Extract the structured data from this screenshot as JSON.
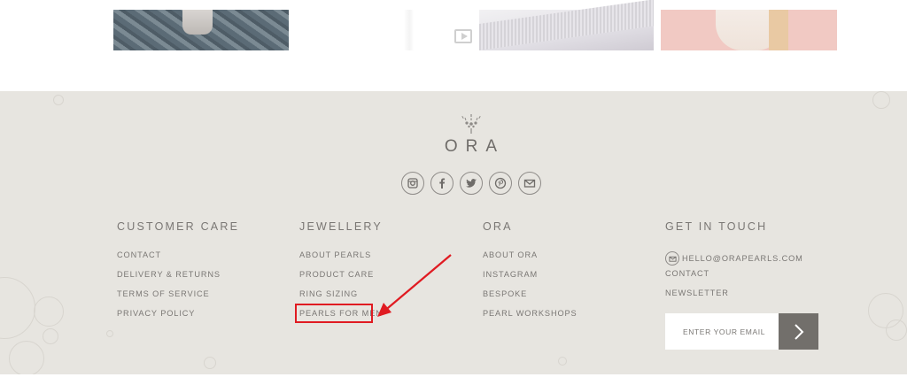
{
  "brand": {
    "name": "ORA",
    "text_color": "#6f6c69"
  },
  "colors": {
    "footer_bg": "#e7e5e0",
    "link_text": "#7a7774",
    "highlight": "#e01b22",
    "submit_bg": "#726f6b"
  },
  "thumbnails": [
    {
      "name": "photo-cobblestone"
    },
    {
      "name": "video-thumbnail",
      "icon": "play-icon"
    },
    {
      "name": "photo-white-wall"
    },
    {
      "name": "photo-pink-model"
    }
  ],
  "socials": [
    {
      "name": "instagram",
      "icon": "instagram-icon"
    },
    {
      "name": "facebook",
      "icon": "facebook-icon"
    },
    {
      "name": "twitter",
      "icon": "twitter-icon"
    },
    {
      "name": "pinterest",
      "icon": "pinterest-icon"
    },
    {
      "name": "email",
      "icon": "mail-icon"
    }
  ],
  "columns": {
    "customer_care": {
      "title": "CUSTOMER CARE",
      "links": [
        "CONTACT",
        "DELIVERY & RETURNS",
        "TERMS OF SERVICE",
        "PRIVACY POLICY"
      ]
    },
    "jewellery": {
      "title": "JEWELLERY",
      "links": [
        "ABOUT PEARLS",
        "PRODUCT CARE",
        "RING SIZING",
        "PEARLS FOR MEN"
      ]
    },
    "ora": {
      "title": "ORA",
      "links": [
        "ABOUT ORA",
        "INSTAGRAM",
        "BESPOKE",
        "PEARL WORKSHOPS"
      ]
    },
    "get_in_touch": {
      "title": "GET IN TOUCH",
      "email": "HELLO@ORAPEARLS.COM",
      "links": [
        "CONTACT",
        "NEWSLETTER"
      ]
    }
  },
  "newsletter": {
    "placeholder": "ENTER YOUR EMAIL",
    "submit_icon": "chevron-right-icon"
  },
  "annotation": {
    "highlighted_link": "PEARLS FOR MEN",
    "arrow_color": "#e01b22"
  }
}
